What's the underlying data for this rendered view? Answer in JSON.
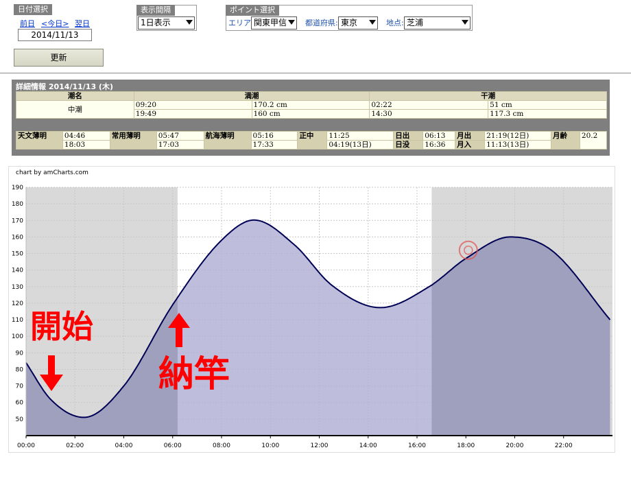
{
  "date_select": {
    "label": "日付選択",
    "prev": "前日",
    "today": "<今日>",
    "next": "翌日",
    "date": "2014/11/13"
  },
  "interval_select": {
    "label": "表示間隔",
    "value": "1日表示"
  },
  "point_select": {
    "label": "ポイント選択",
    "area_label": "エリア:",
    "area_value": "関東甲信",
    "pref_label": "都道府県:",
    "pref_value": "東京",
    "spot_label": "地点:",
    "spot_value": "芝浦"
  },
  "update_button": "更新",
  "detail": {
    "title": "詳細情報 2014/11/13 (木)",
    "tide_name_header": "潮名",
    "high_header": "満潮",
    "low_header": "干潮",
    "tide_name": "中潮",
    "high": [
      {
        "time": "09:20",
        "height": "170.2 cm"
      },
      {
        "time": "19:49",
        "height": "160 cm"
      }
    ],
    "low": [
      {
        "time": "02:22",
        "height": "51 cm"
      },
      {
        "time": "14:30",
        "height": "117.3 cm"
      }
    ],
    "astro": {
      "astro_twilight_label": "天文薄明",
      "astro_twilight": [
        "04:46",
        "18:03"
      ],
      "civil_twilight_label": "常用薄明",
      "civil_twilight": [
        "05:47",
        "17:03"
      ],
      "nautical_twilight_label": "航海薄明",
      "nautical_twilight": [
        "05:16",
        "17:33"
      ],
      "meridian_label": "正中",
      "meridian": [
        "11:25",
        "04:19(13日)"
      ],
      "sunrise_label": "日出",
      "sunrise": "06:13",
      "sunset_label": "日没",
      "sunset": "16:36",
      "moonrise_label": "月出",
      "moonrise": "21:19(12日)",
      "moonset_label": "月入",
      "moonset": "11:13(13日)",
      "moon_age_label": "月齢",
      "moon_age": "20.2"
    }
  },
  "chart_credit": "chart by amCharts.com",
  "annotations": {
    "start": "開始",
    "retract": "納竿"
  },
  "colors": {
    "night_band": "#d9d9d9",
    "fill": "#b3b3d6",
    "line": "#000055",
    "marker": "#e05050",
    "annotation": "#ff0000"
  },
  "chart_data": {
    "type": "area",
    "title": "",
    "xlabel": "",
    "ylabel": "",
    "x_ticks": [
      "00:00",
      "02:00",
      "04:00",
      "06:00",
      "08:00",
      "10:00",
      "12:00",
      "14:00",
      "16:00",
      "18:00",
      "20:00",
      "22:00"
    ],
    "xlim": [
      0,
      24
    ],
    "ylim": [
      40,
      190
    ],
    "y_ticks": [
      50,
      60,
      70,
      80,
      90,
      100,
      110,
      120,
      130,
      140,
      150,
      160,
      170,
      180,
      190
    ],
    "grid": true,
    "night_bands": [
      [
        0,
        6.2
      ],
      [
        16.6,
        24
      ]
    ],
    "highlight_range": [
      0,
      6.2
    ],
    "series": [
      {
        "x": [
          0,
          1,
          2.37,
          4,
          6,
          8,
          9.33,
          11,
          12.5,
          14.5,
          16.5,
          18,
          19.82,
          21.5,
          23.9
        ],
        "values": [
          84,
          62,
          51,
          70,
          119,
          158,
          170.2,
          155,
          131,
          117.3,
          130,
          147,
          160,
          152,
          110
        ]
      }
    ],
    "marker": {
      "x": 18.1,
      "y": 152
    }
  }
}
